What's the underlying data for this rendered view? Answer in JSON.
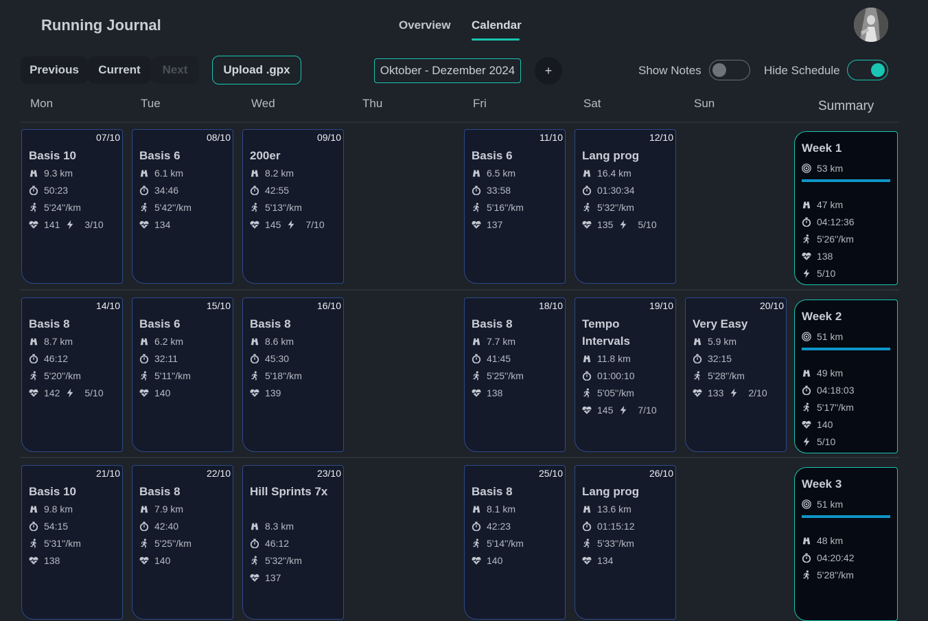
{
  "app": {
    "title": "Running Journal"
  },
  "nav": {
    "tabs": [
      {
        "label": "Overview"
      },
      {
        "label": "Calendar",
        "active": true
      }
    ]
  },
  "toolbar": {
    "previous": "Previous",
    "current": "Current",
    "next": "Next",
    "upload": "Upload .gpx",
    "date_range": "Oktober - Dezember 2024",
    "add": "+",
    "show_notes": {
      "label": "Show Notes",
      "on": false
    },
    "hide_schedule": {
      "label": "Hide Schedule",
      "on": true
    }
  },
  "days": [
    "Mon",
    "Tue",
    "Wed",
    "Thu",
    "Fri",
    "Sat",
    "Sun"
  ],
  "summary_header": "Summary",
  "colors": {
    "accent": "#19c6b3",
    "card_border": "#2e4a8a",
    "progress": "#0e96c8",
    "background": "#1e2229"
  },
  "weeks": [
    {
      "cells": [
        {
          "date": "07/10",
          "title": "Basis 10",
          "distance": "9.3 km",
          "time": "50:23",
          "pace": "5'24''/km",
          "hr": "141",
          "effort": "3/10"
        },
        {
          "date": "08/10",
          "title": "Basis 6",
          "distance": "6.1 km",
          "time": "34:46",
          "pace": "5'42''/km",
          "hr": "134"
        },
        {
          "date": "09/10",
          "title": "200er",
          "distance": "8.2 km",
          "time": "42:55",
          "pace": "5'13''/km",
          "hr": "145",
          "effort": "7/10"
        },
        null,
        {
          "date": "11/10",
          "title": "Basis 6",
          "distance": "6.5 km",
          "time": "33:58",
          "pace": "5'16''/km",
          "hr": "137"
        },
        {
          "date": "12/10",
          "title": "Lang prog",
          "distance": "16.4 km",
          "time": "01:30:34",
          "pace": "5'32''/km",
          "hr": "135",
          "effort": "5/10"
        },
        null
      ],
      "summary": {
        "week": "Week 1",
        "goal": "53 km",
        "distance": "47 km",
        "time": "04:12:36",
        "pace": "5'26''/km",
        "hr": "138",
        "effort": "5/10"
      }
    },
    {
      "cells": [
        {
          "date": "14/10",
          "title": "Basis 8",
          "distance": "8.7 km",
          "time": "46:12",
          "pace": "5'20''/km",
          "hr": "142",
          "effort": "5/10"
        },
        {
          "date": "15/10",
          "title": "Basis 6",
          "distance": "6.2 km",
          "time": "32:11",
          "pace": "5'11''/km",
          "hr": "140"
        },
        {
          "date": "16/10",
          "title": "Basis 8",
          "distance": "8.6 km",
          "time": "45:30",
          "pace": "5'18''/km",
          "hr": "139"
        },
        null,
        {
          "date": "18/10",
          "title": "Basis 8",
          "distance": "7.7 km",
          "time": "41:45",
          "pace": "5'25''/km",
          "hr": "138"
        },
        {
          "date": "19/10",
          "title": "Tempo Intervals",
          "distance": "11.8 km",
          "time": "01:00:10",
          "pace": "5'05''/km",
          "hr": "145",
          "effort": "7/10"
        },
        {
          "date": "20/10",
          "title": "Very Easy",
          "distance": "5.9 km",
          "time": "32:15",
          "pace": "5'28''/km",
          "hr": "133",
          "effort": "2/10"
        }
      ],
      "summary": {
        "week": "Week 2",
        "goal": "51 km",
        "distance": "49 km",
        "time": "04:18:03",
        "pace": "5'17''/km",
        "hr": "140",
        "effort": "5/10"
      }
    },
    {
      "cells": [
        {
          "date": "21/10",
          "title": "Basis 10",
          "distance": "9.8 km",
          "time": "54:15",
          "pace": "5'31''/km",
          "hr": "138"
        },
        {
          "date": "22/10",
          "title": "Basis 8",
          "distance": "7.9 km",
          "time": "42:40",
          "pace": "5'25''/km",
          "hr": "140"
        },
        {
          "date": "23/10",
          "title": "Hill Sprints 7x",
          "distance": "8.3 km",
          "time": "46:12",
          "pace": "5'32''/km",
          "hr": "137"
        },
        null,
        {
          "date": "25/10",
          "title": "Basis 8",
          "distance": "8.1 km",
          "time": "42:23",
          "pace": "5'14''/km",
          "hr": "140"
        },
        {
          "date": "26/10",
          "title": "Lang prog",
          "distance": "13.6 km",
          "time": "01:15:12",
          "pace": "5'33''/km",
          "hr": "134"
        },
        null
      ],
      "summary": {
        "week": "Week 3",
        "goal": "51 km",
        "distance": "48 km",
        "time": "04:20:42",
        "pace": "5'28''/km"
      }
    }
  ]
}
